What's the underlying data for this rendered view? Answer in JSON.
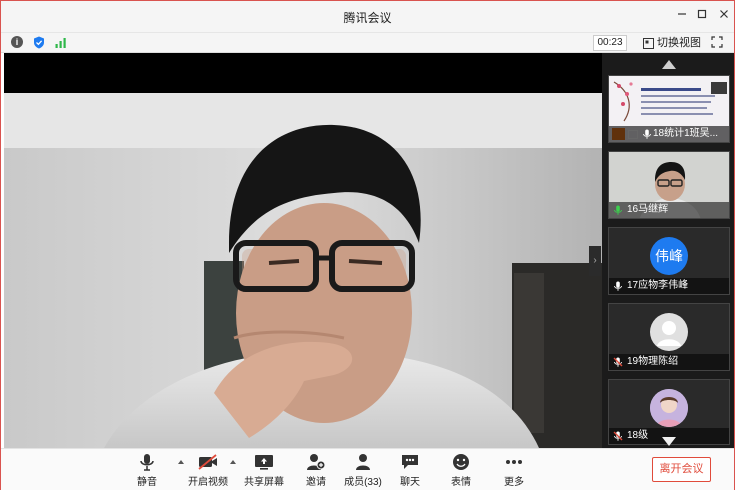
{
  "window": {
    "title": "腾讯会议",
    "controls": [
      "minimize",
      "maximize",
      "close"
    ]
  },
  "infobar": {
    "timer": "00:23",
    "switch_view_label": "切换视图",
    "icons": [
      "info-icon",
      "shield-icon",
      "signal-icon",
      "fullscreen-icon"
    ]
  },
  "participants": [
    {
      "label": "18统计1班吴...",
      "type": "screen-share",
      "mic": "on"
    },
    {
      "label": "16马继辉",
      "type": "video",
      "mic": "active"
    },
    {
      "label": "17应物李伟峰",
      "type": "avatar",
      "avatar_text": "伟峰",
      "avatar_color": "#1e7bf0",
      "mic": "on"
    },
    {
      "label": "19物理陈绍",
      "type": "avatar",
      "avatar_text": "",
      "avatar_color": "#e0e0e0",
      "mic": "muted"
    },
    {
      "label": "18级",
      "type": "avatar",
      "avatar_text": "",
      "avatar_color": "#b9a6d6",
      "mic": "muted"
    }
  ],
  "toolbar": {
    "mute_label": "静音",
    "video_label": "开启视频",
    "share_label": "共享屏幕",
    "invite_label": "邀请",
    "members_label": "成员(33)",
    "chat_label": "聊天",
    "emoji_label": "表情",
    "more_label": "更多",
    "leave_label": "离开会议"
  },
  "colors": {
    "accent_red": "#e04b3b",
    "sidebar_bg": "#1b1b1b",
    "avatar_blue": "#1e7bf0",
    "active_mic_green": "#3ccf4e"
  }
}
